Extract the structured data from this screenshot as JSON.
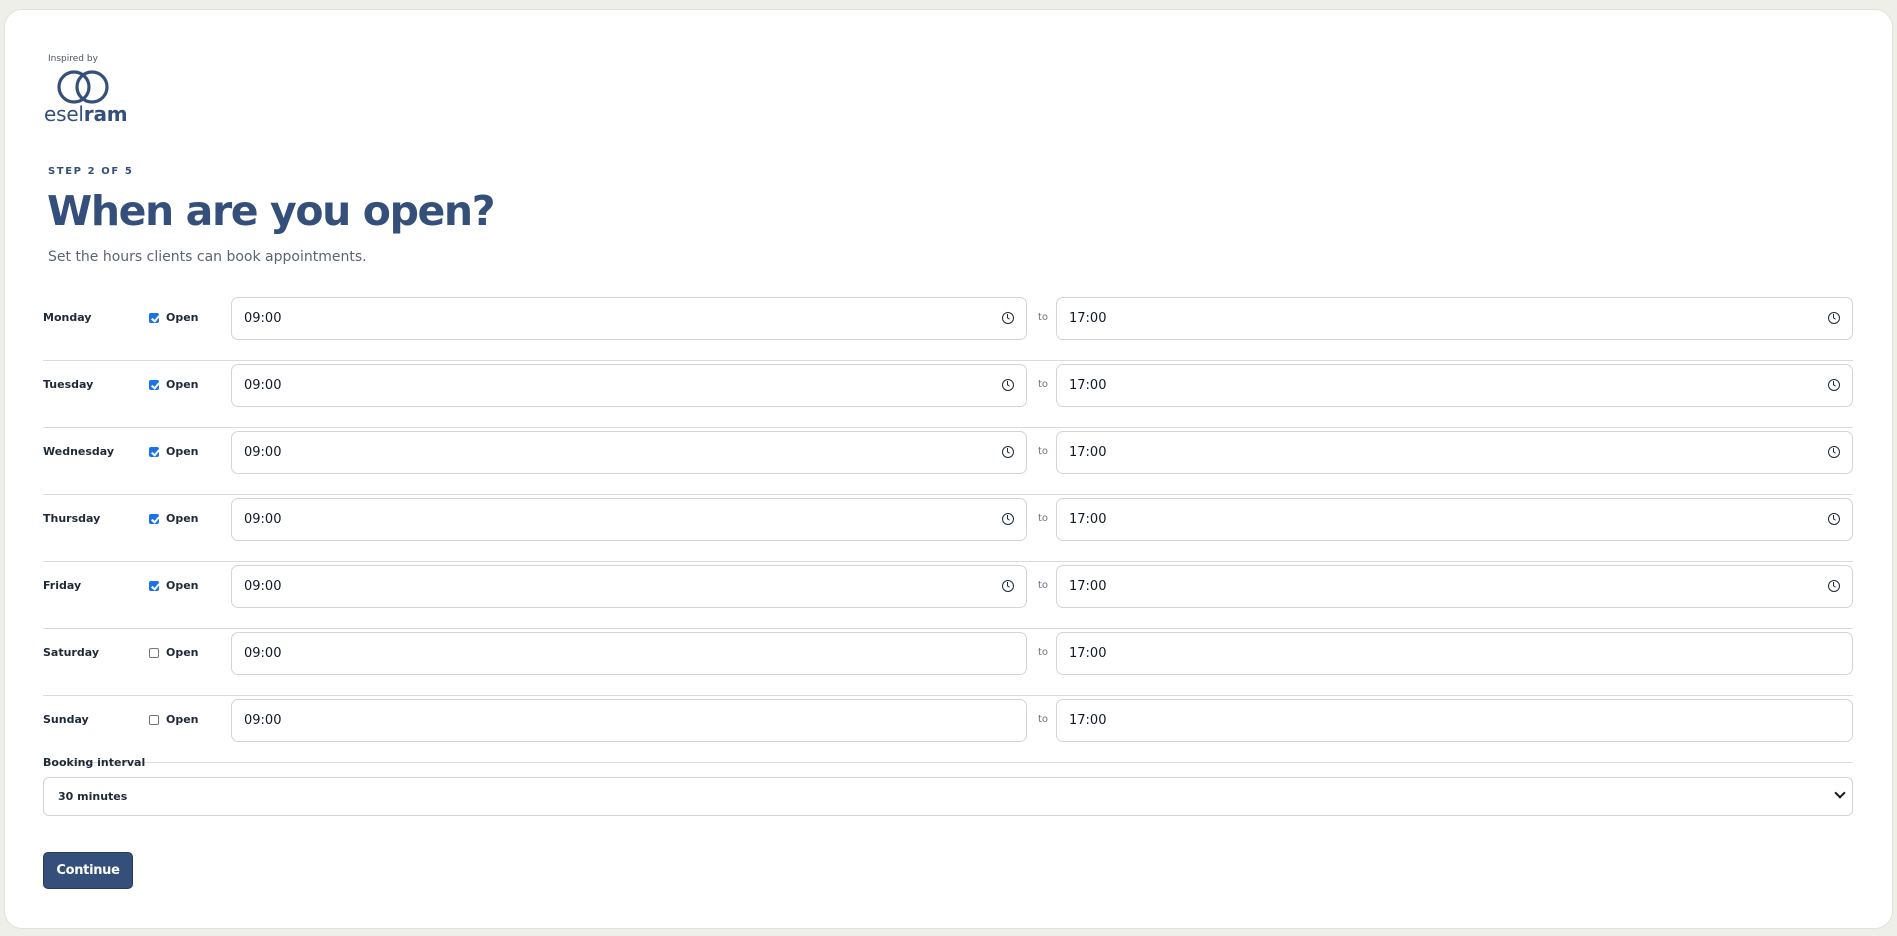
{
  "brand": {
    "inspired_by": "Inspired by",
    "name_light": "esel",
    "name_bold": "ram",
    "logo_icon": "interlocking-rings-icon",
    "color": "#34507a"
  },
  "header": {
    "step": "STEP 2 OF 5",
    "title": "When are you open?",
    "subtitle": "Set the hours clients can book appointments."
  },
  "schedule": {
    "open_label": "Open",
    "separator": "to",
    "days": [
      {
        "day": "Monday",
        "open": true,
        "from": "09:00",
        "to": "17:00"
      },
      {
        "day": "Tuesday",
        "open": true,
        "from": "09:00",
        "to": "17:00"
      },
      {
        "day": "Wednesday",
        "open": true,
        "from": "09:00",
        "to": "17:00"
      },
      {
        "day": "Thursday",
        "open": true,
        "from": "09:00",
        "to": "17:00"
      },
      {
        "day": "Friday",
        "open": true,
        "from": "09:00",
        "to": "17:00"
      },
      {
        "day": "Saturday",
        "open": false,
        "from": "09:00",
        "to": "17:00"
      },
      {
        "day": "Sunday",
        "open": false,
        "from": "09:00",
        "to": "17:00"
      }
    ]
  },
  "booking": {
    "label": "Booking interval",
    "selected": "30 minutes"
  },
  "actions": {
    "continue_label": "Continue"
  },
  "colors": {
    "accent": "#34507a",
    "checkbox": "#1a73e8",
    "background": "#efefe9"
  }
}
